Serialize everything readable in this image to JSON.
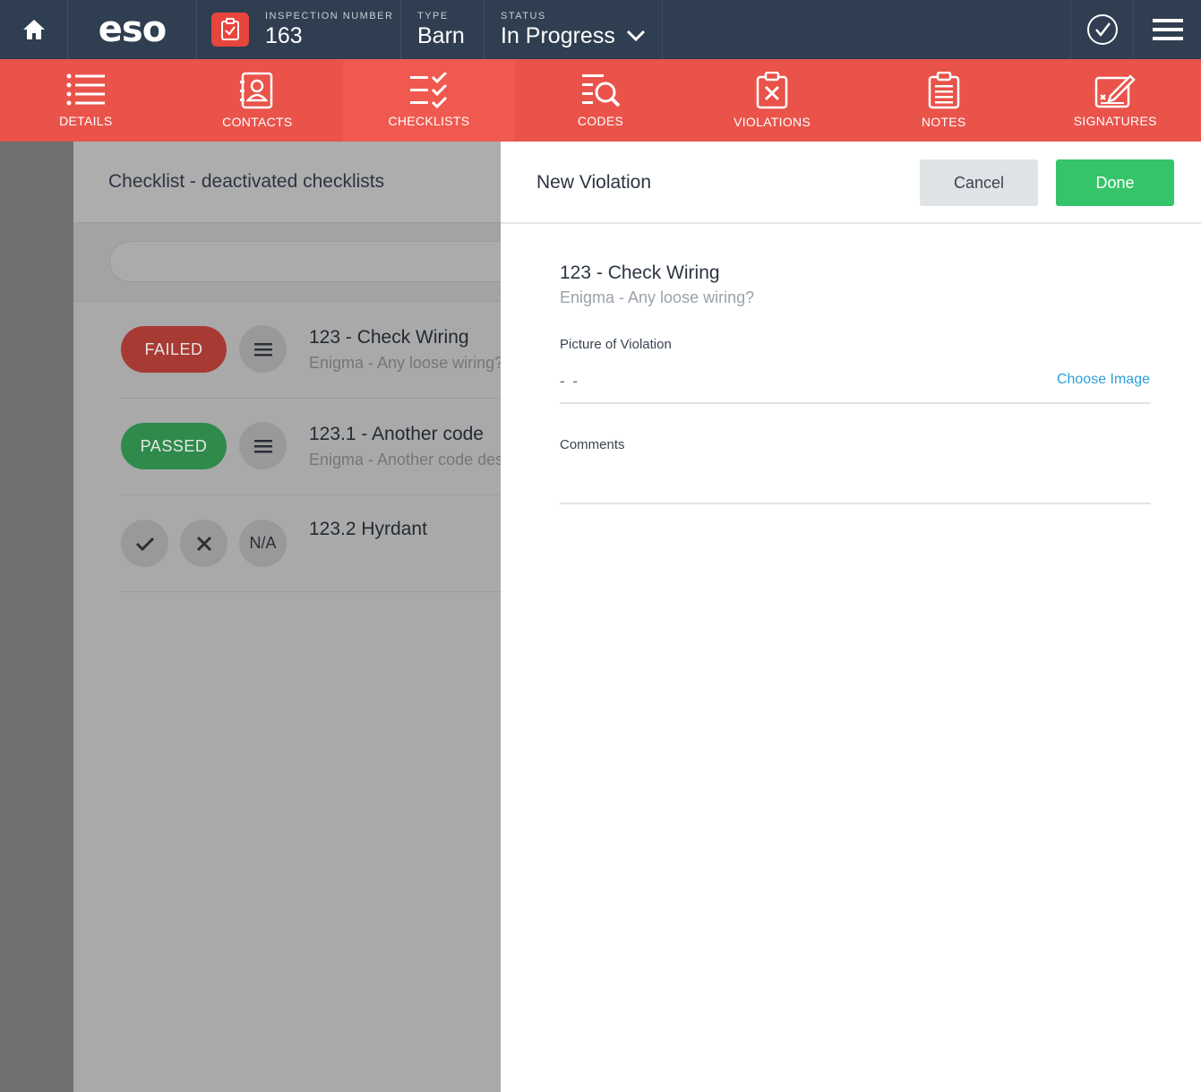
{
  "header": {
    "logo": "eso",
    "inspection_number_label": "INSPECTION NUMBER",
    "inspection_number": "163",
    "type_label": "TYPE",
    "type_value": "Barn",
    "status_label": "STATUS",
    "status_value": "In Progress"
  },
  "nav": {
    "tabs": [
      {
        "label": "DETAILS",
        "icon": "list-icon"
      },
      {
        "label": "CONTACTS",
        "icon": "contacts-icon"
      },
      {
        "label": "CHECKLISTS",
        "icon": "checklist-icon"
      },
      {
        "label": "CODES",
        "icon": "search-list-icon"
      },
      {
        "label": "VIOLATIONS",
        "icon": "clipboard-x-icon"
      },
      {
        "label": "NOTES",
        "icon": "notes-icon"
      },
      {
        "label": "SIGNATURES",
        "icon": "signature-icon"
      }
    ],
    "active": "CHECKLISTS"
  },
  "checklist": {
    "title": "Checklist - deactivated checklists",
    "items": [
      {
        "status": "FAILED",
        "title": "123 - Check Wiring",
        "subtitle": "Enigma - Any loose wiring?"
      },
      {
        "status": "PASSED",
        "title": "123.1 - Another code",
        "subtitle": "Enigma - Another code description"
      },
      {
        "status": "",
        "title": "123.2 Hyrdant",
        "subtitle": ""
      }
    ],
    "na_label": "N/A"
  },
  "violation": {
    "title": "New Violation",
    "cancel_label": "Cancel",
    "done_label": "Done",
    "code_title": "123 - Check Wiring",
    "code_subtitle": "Enigma - Any loose wiring?",
    "picture_label": "Picture of Violation",
    "picture_value": "- -",
    "choose_image_label": "Choose Image",
    "comments_label": "Comments"
  },
  "colors": {
    "topbar": "#2f3e50",
    "nav": "#e9534a",
    "failed": "#a83a34",
    "passed": "#2f8a4c",
    "done": "#35c46a",
    "link": "#2b9fd9"
  }
}
